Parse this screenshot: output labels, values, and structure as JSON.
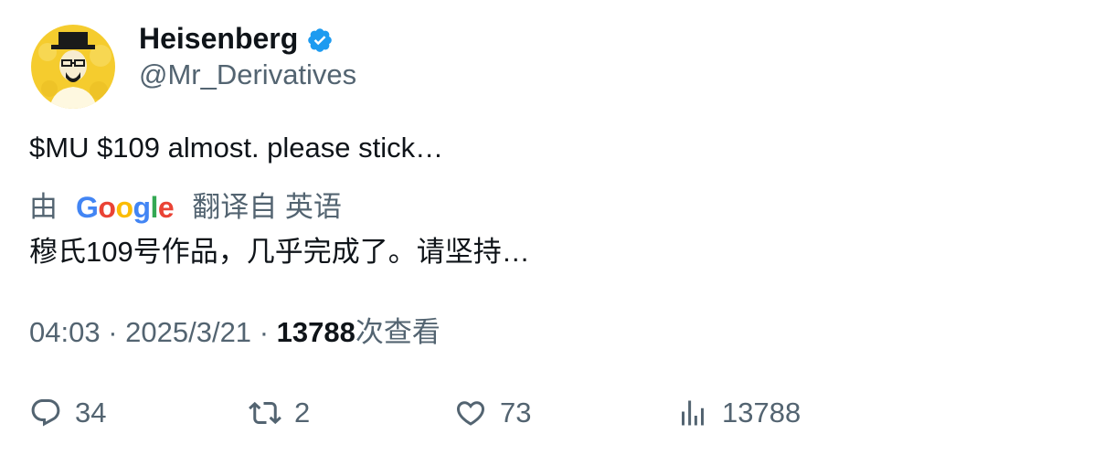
{
  "author": {
    "name": "Heisenberg",
    "handle": "@Mr_Derivatives",
    "verified": true,
    "verified_color": "#1d9bf0"
  },
  "tweet": {
    "text": "$MU $109 almost. please stick…"
  },
  "translation": {
    "prefix": "由",
    "provider": "Google",
    "suffix": "翻译自 英语",
    "text": "穆氏109号作品，几乎完成了。请坚持…"
  },
  "meta": {
    "time": "04:03",
    "date": "2025/3/21",
    "views": "13788",
    "views_label": "次查看"
  },
  "actions": {
    "reply_count": "34",
    "retweet_count": "2",
    "like_count": "73",
    "views_count": "13788"
  },
  "icons": [
    "verified-badge-icon",
    "reply-icon",
    "retweet-icon",
    "like-icon",
    "views-icon"
  ],
  "colors": {
    "text": "#0f1419",
    "secondary": "#536471",
    "avatar_bg": "#f5cc2e",
    "google_blue": "#4285f4",
    "google_red": "#ea4335",
    "google_yellow": "#fbbc05",
    "google_green": "#34a853"
  }
}
